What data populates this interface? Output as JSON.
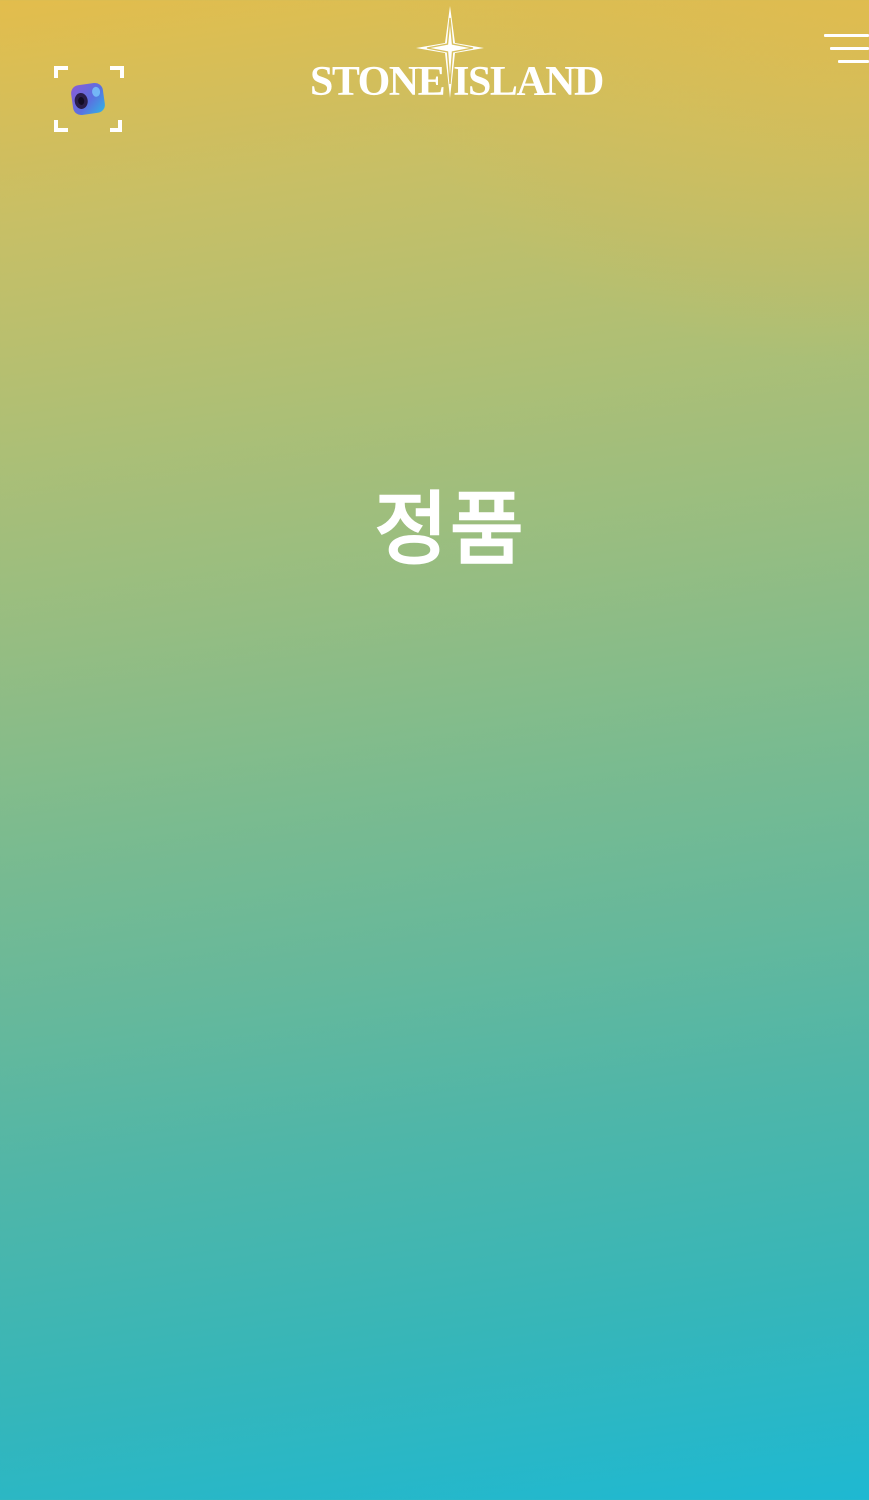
{
  "header": {
    "logo_text": "STONE ISLAND",
    "scan_icon": "ar-scan-cube-icon",
    "menu_icon": "hamburger-menu-icon"
  },
  "main": {
    "headline": "정품"
  },
  "colors": {
    "gradient_top": "#e3bd4c",
    "gradient_middle": "#7bbb8f",
    "gradient_bottom": "#1eb8d2",
    "foreground": "#ffffff"
  }
}
